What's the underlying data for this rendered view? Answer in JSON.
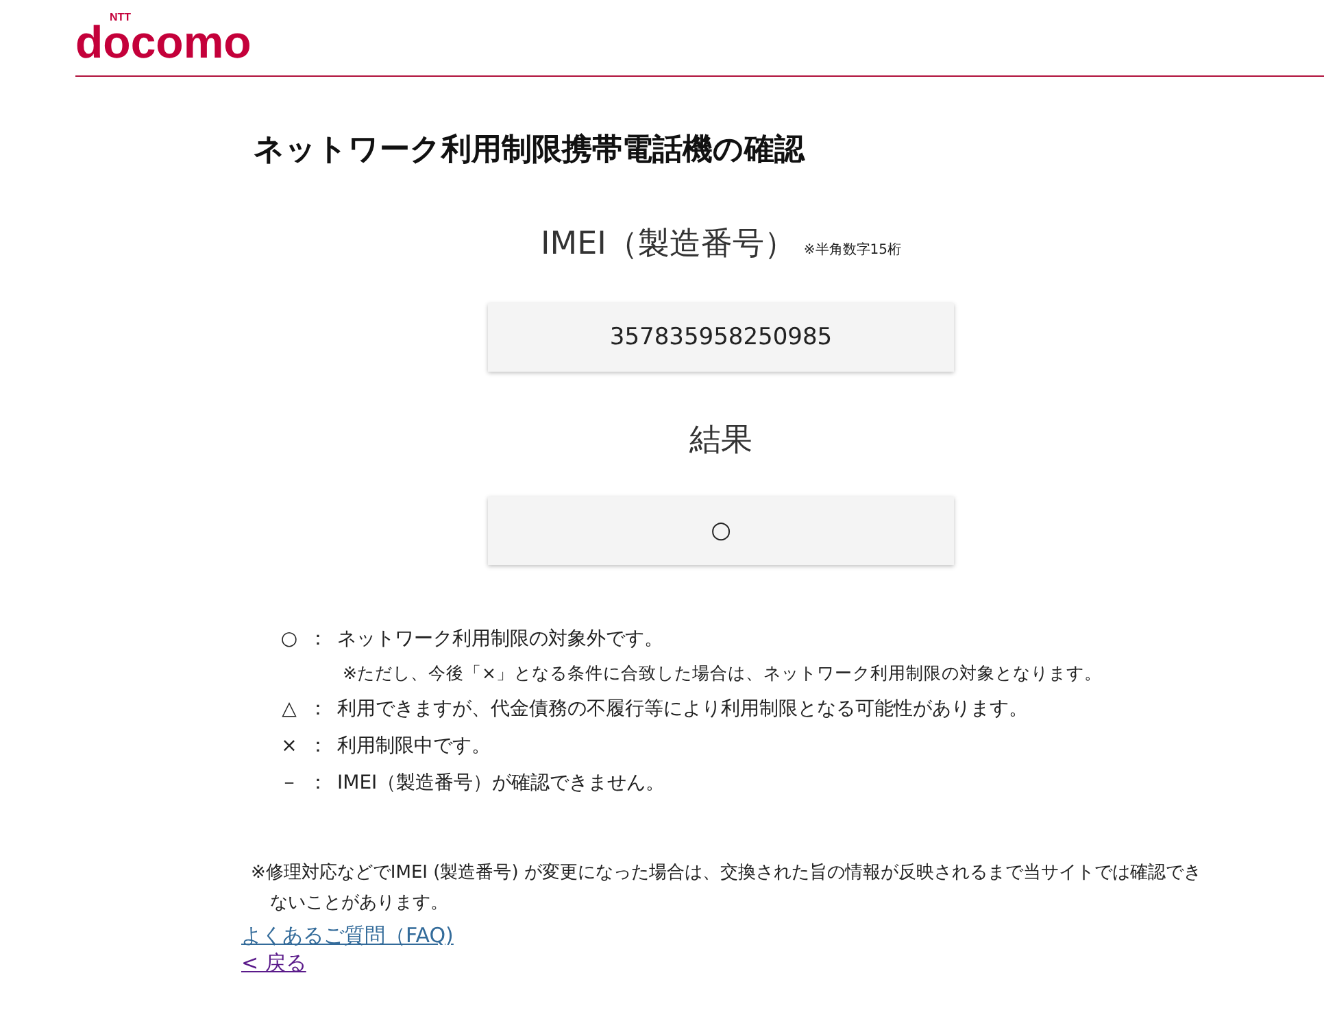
{
  "header": {
    "logo_small": "NTT",
    "logo": "docomo"
  },
  "title": "ネットワーク利用制限携帯電話機の確認",
  "imei": {
    "label": "IMEI（製造番号）",
    "hint": "※半角数字15桁",
    "value": "357835958250985"
  },
  "result": {
    "label": "結果",
    "value": "○"
  },
  "legend": [
    {
      "kind": "item",
      "symbol": "○",
      "colon": "：",
      "text": "ネットワーク利用制限の対象外です。"
    },
    {
      "kind": "note",
      "text": "※ただし、今後「×」となる条件に合致した場合は、ネットワーク利用制限の対象となります。"
    },
    {
      "kind": "item",
      "symbol": "△",
      "colon": "：",
      "text": "利用できますが、代金債務の不履行等により利用制限となる可能性があります。"
    },
    {
      "kind": "item",
      "symbol": "×",
      "colon": "：",
      "text": "利用制限中です。"
    },
    {
      "kind": "item",
      "symbol": "－",
      "colon": "：",
      "text": "IMEI（製造番号）が確認できません。"
    }
  ],
  "footnote": "※修理対応などでIMEI (製造番号) が変更になった場合は、交換された旨の情報が反映されるまで当サイトでは確認できないことがあります。",
  "links": [
    {
      "text": "よくあるご質問（FAQ)",
      "visited": false
    },
    {
      "text": "< 戻る",
      "visited": true
    }
  ]
}
